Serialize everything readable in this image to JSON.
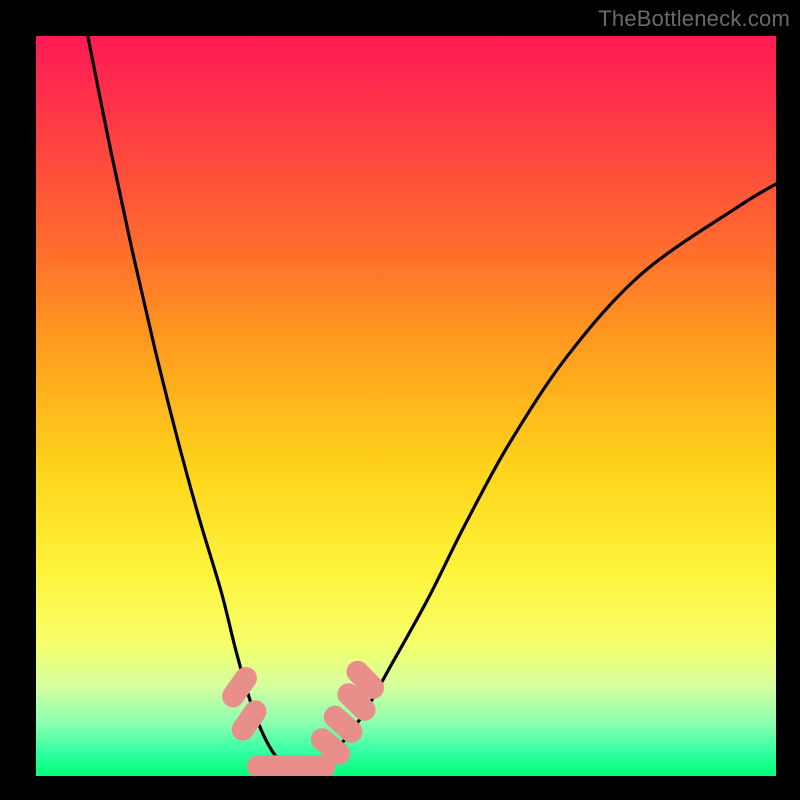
{
  "watermark": "TheBottleneck.com",
  "colors": {
    "background": "#000000",
    "curve": "#000000",
    "marker_fill": "#e98f8b",
    "marker_stroke": "#e98f8b"
  },
  "chart_data": {
    "type": "line",
    "title": "",
    "xlabel": "",
    "ylabel": "",
    "xlim": [
      0,
      100
    ],
    "ylim": [
      0,
      100
    ],
    "grid": false,
    "legend": false,
    "series": [
      {
        "name": "bottleneck-curve",
        "x": [
          7,
          10,
          13,
          16,
          19,
          22,
          25,
          27,
          29,
          31,
          33,
          35,
          37,
          40,
          44,
          48,
          53,
          58,
          64,
          72,
          82,
          95,
          100
        ],
        "y": [
          100,
          85,
          71,
          58,
          46,
          35,
          25,
          17,
          10,
          5,
          2,
          1,
          1,
          3,
          8,
          15,
          24,
          34,
          45,
          57,
          68,
          77,
          80
        ]
      }
    ],
    "markers": [
      {
        "shape": "capsule",
        "cx": 27.5,
        "cy": 12.0,
        "w": 6,
        "h": 3,
        "angle": -55
      },
      {
        "shape": "capsule",
        "cx": 28.8,
        "cy": 7.5,
        "w": 6,
        "h": 3,
        "angle": -55
      },
      {
        "shape": "capsule",
        "cx": 31.5,
        "cy": 1.3,
        "w": 6,
        "h": 3,
        "angle": 0
      },
      {
        "shape": "capsule",
        "cx": 34.5,
        "cy": 1.3,
        "w": 6,
        "h": 3,
        "angle": 0
      },
      {
        "shape": "capsule",
        "cx": 37.5,
        "cy": 1.3,
        "w": 6,
        "h": 3,
        "angle": 0
      },
      {
        "shape": "capsule",
        "cx": 39.8,
        "cy": 4.0,
        "w": 6,
        "h": 3,
        "angle": 40
      },
      {
        "shape": "capsule",
        "cx": 41.5,
        "cy": 7.0,
        "w": 6,
        "h": 3,
        "angle": 42
      },
      {
        "shape": "capsule",
        "cx": 43.3,
        "cy": 10.0,
        "w": 6,
        "h": 3,
        "angle": 44
      },
      {
        "shape": "capsule",
        "cx": 44.5,
        "cy": 13.0,
        "w": 6,
        "h": 3,
        "angle": 46
      }
    ]
  }
}
